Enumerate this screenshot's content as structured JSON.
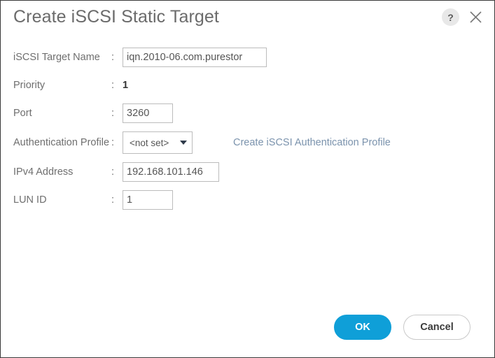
{
  "dialog": {
    "title": "Create iSCSI Static Target",
    "help_icon_glyph": "?",
    "help_icon_name": "question-mark-icon",
    "close_icon_name": "close-icon",
    "accent_color": "#0f9fd8",
    "link_color": "#7b93ad",
    "label_color": "#6f6f6f",
    "border_color": "#bcbcbc"
  },
  "form": {
    "fields": [
      {
        "label": "iSCSI Target Name",
        "separator": ":",
        "type": "text",
        "value": "iqn.2010-06.com.purestor",
        "placeholder": ""
      },
      {
        "label": "Priority",
        "separator": ":",
        "type": "static",
        "value": "1"
      },
      {
        "label": "Port",
        "separator": ":",
        "type": "text",
        "value": "3260",
        "placeholder": ""
      },
      {
        "label": "Authentication Profile",
        "separator": ":",
        "type": "select",
        "value": "<not set>",
        "caret_icon": "chevron-down-icon",
        "link_label": "Create iSCSI Authentication Profile"
      },
      {
        "label": "IPv4 Address",
        "separator": ":",
        "type": "text",
        "value": "192.168.101.146",
        "placeholder": ""
      },
      {
        "label": "LUN ID",
        "separator": ":",
        "type": "text",
        "value": "1",
        "placeholder": ""
      }
    ]
  },
  "footer": {
    "ok_label": "OK",
    "cancel_label": "Cancel"
  }
}
